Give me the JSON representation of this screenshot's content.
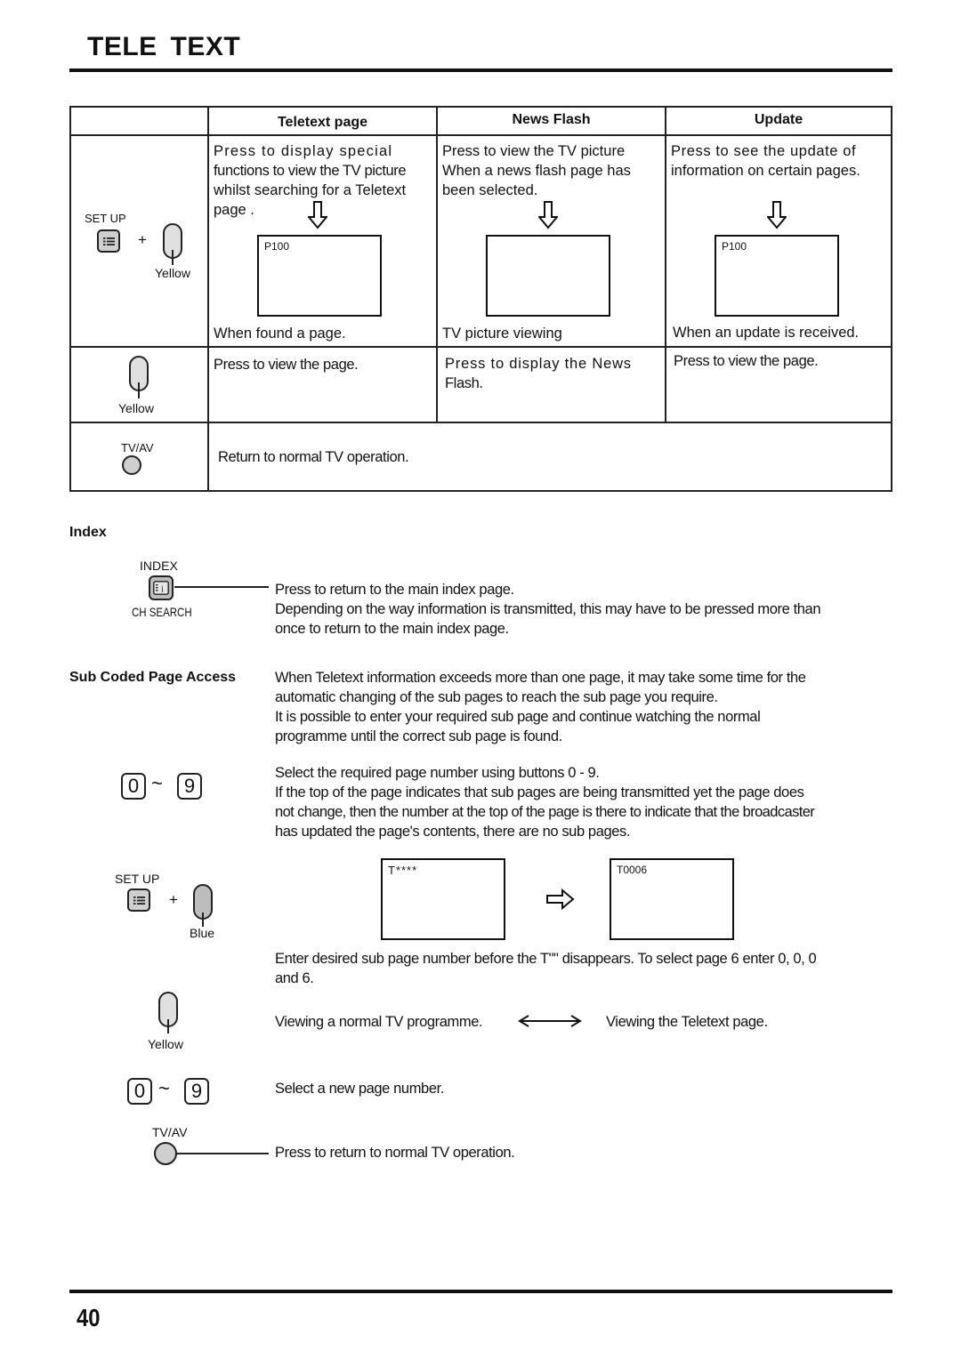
{
  "header": {
    "title": "TELE  TEXT"
  },
  "footer": {
    "page_number": "40"
  },
  "table": {
    "headers": [
      "",
      "Teletext page",
      "News Flash",
      "Update"
    ],
    "row1": {
      "setup_label": "SET UP",
      "plus": "+",
      "yellow_label": "Yellow",
      "teletext_page": {
        "line1": "Press  to display special",
        "line2": "functions to view the TV picture",
        "line3": "whilst searching for a Teletext",
        "line4": "page .",
        "screen_label": "P100",
        "caption": "When found a page."
      },
      "news_flash": {
        "line1": "Press to view the TV picture",
        "line2": "When a news flash page has",
        "line3": "been selected.",
        "screen_label": "",
        "caption": "TV picture viewing"
      },
      "update": {
        "line1": "Press  to see the update of",
        "line2": "information on certain pages.",
        "screen_label": "P100",
        "caption": "When an update is received."
      }
    },
    "row2": {
      "yellow_label": "Yellow",
      "teletext_page": "Press to view the page.",
      "news_flash_line1": "Press to display the News",
      "news_flash_line2": "Flash.",
      "update": "Press to view the page."
    },
    "row3": {
      "tvav_label": "TV/AV",
      "text": "Return to normal TV operation."
    }
  },
  "index_section": {
    "heading": "Index",
    "index_label": "INDEX",
    "ch_search_label": "CH SEARCH",
    "line1": "Press  to return to the main index page.",
    "line2": "Depending on the way information is transmitted, this may have to be pressed more than",
    "line3": "once to return to the main index page."
  },
  "sub_coded": {
    "heading": "Sub Coded Page Access",
    "para1": [
      "When Teletext information exceeds more than one page, it may take some time for the",
      "automatic changing of the sub pages to reach the sub page you require.",
      "It is possible to enter your required sub page and continue watching the normal",
      "programme until the correct sub page is found."
    ],
    "key_0": "0",
    "key_9": "9",
    "tilde": "~",
    "para2": [
      "Select the required page number using buttons 0 - 9.",
      "If the top of the page indicates that sub pages are being transmitted yet the page does",
      "not change, then the number at the top of the page is there to indicate that the broadcaster",
      "has updated the page's contents, there are no sub pages."
    ],
    "setup_label": "SET UP",
    "plus": "+",
    "blue_label": "Blue",
    "screen_before": "T****",
    "screen_after": "T0006",
    "para3": [
      "Enter desired sub page number before the T\"\" disappears. To select page 6 enter 0, 0, 0",
      "and 6."
    ],
    "yellow_label": "Yellow",
    "viewing_tv": "Viewing a normal TV programme.",
    "viewing_teletext": "Viewing the Teletext page.",
    "select_new": "Select a new page number.",
    "tvav_label": "TV/AV",
    "return_normal": "Press to return to normal TV operation."
  }
}
